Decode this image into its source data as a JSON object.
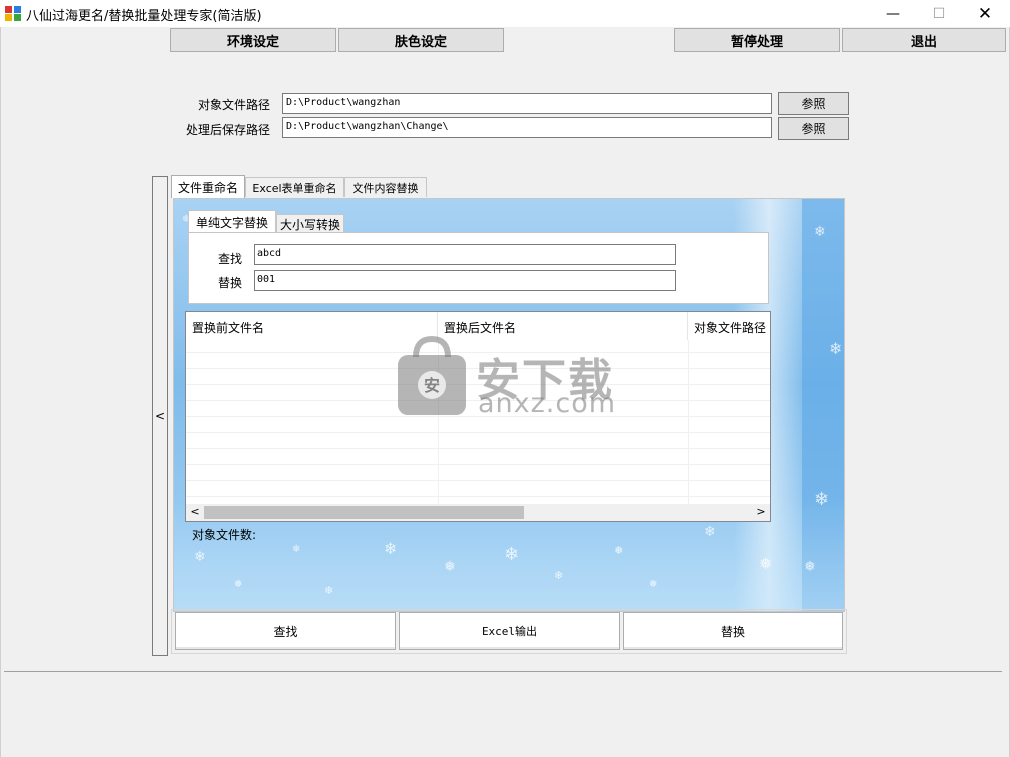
{
  "window": {
    "title": "八仙过海更名/替换批量处理专家(简洁版)",
    "minimize_symbol": "—",
    "maximize_symbol": "☐",
    "close_symbol": "✕"
  },
  "toolbar": {
    "env_settings": "环境设定",
    "skin_settings": "肤色设定",
    "pause": "暂停处理",
    "exit": "退出"
  },
  "paths": {
    "target_label": "对象文件路径",
    "target_value": "D:\\Product\\wangzhan",
    "save_label": "处理后保存路径",
    "save_value": "D:\\Product\\wangzhan\\Change\\",
    "browse_label": "参照"
  },
  "collapse_symbol": "<",
  "tabs": {
    "rename": "文件重命名",
    "excel_rename": "Excel表单重命名",
    "content_replace": "文件内容替换"
  },
  "inner_tabs": {
    "plain_text": "单纯文字替换",
    "case_convert": "大小写转换"
  },
  "search": {
    "find_label": "查找",
    "find_value": "abcd",
    "replace_label": "替换",
    "replace_value": "001"
  },
  "grid": {
    "columns": [
      "置换前文件名",
      "置换后文件名",
      "对象文件路径"
    ],
    "scroll_left": "<",
    "scroll_right": ">"
  },
  "watermark": {
    "cn": "安下载",
    "en": "anxz.com",
    "logo_letter": "安"
  },
  "file_count_label": "对象文件数:",
  "actions": {
    "find": "查找",
    "excel_export": "Excel输出",
    "replace": "替换"
  },
  "colors": {
    "snow_background": "#8cc4ee",
    "title_bar": "#ffffff"
  }
}
